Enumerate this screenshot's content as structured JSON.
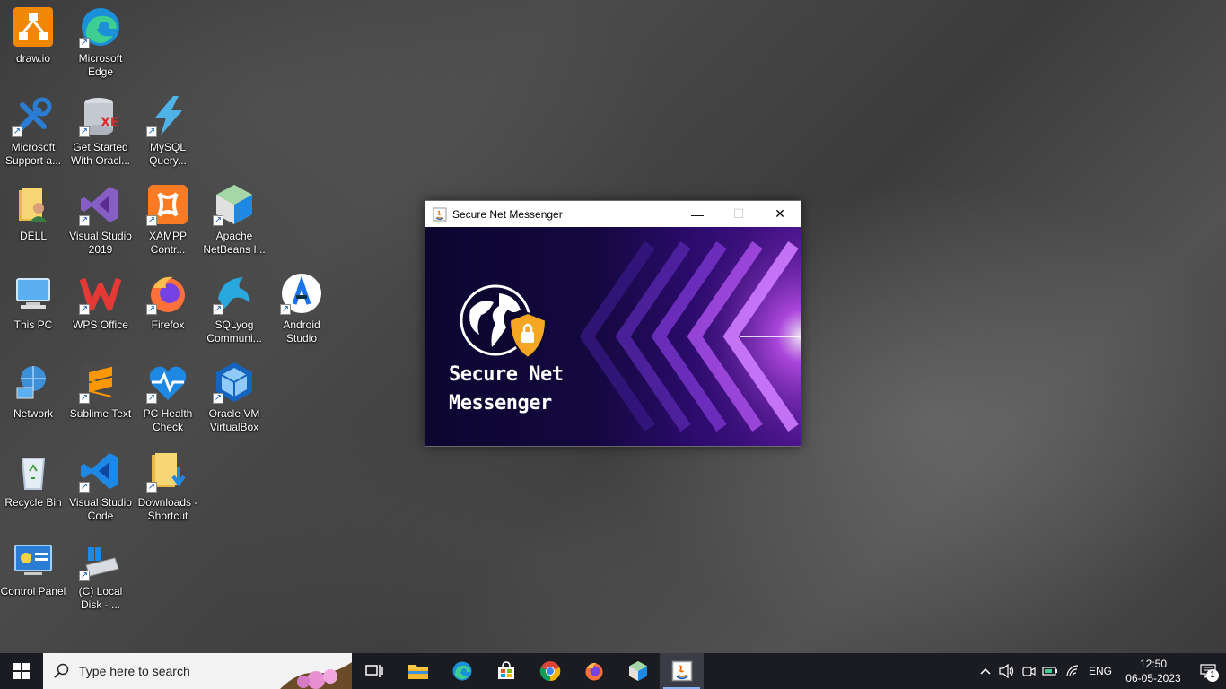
{
  "desktop": {
    "icons": [
      {
        "label": "draw.io",
        "icon": "drawio-icon"
      },
      {
        "label": "Microsoft Edge",
        "icon": "edge-icon"
      },
      {
        "label": "Microsoft Support a...",
        "icon": "tools-icon"
      },
      {
        "label": "Get Started With Oracl...",
        "icon": "oracle-db-icon"
      },
      {
        "label": "MySQL Query...",
        "icon": "lightning-icon"
      },
      {
        "label": "DELL",
        "icon": "user-folder-icon"
      },
      {
        "label": "Visual Studio 2019",
        "icon": "visual-studio-icon"
      },
      {
        "label": "XAMPP Contr...",
        "icon": "xampp-icon"
      },
      {
        "label": "Apache NetBeans I...",
        "icon": "netbeans-icon"
      },
      {
        "label": "This PC",
        "icon": "computer-icon"
      },
      {
        "label": "WPS Office",
        "icon": "wps-icon"
      },
      {
        "label": "Firefox",
        "icon": "firefox-icon"
      },
      {
        "label": "SQLyog Communi...",
        "icon": "dolphin-icon"
      },
      {
        "label": "Android Studio",
        "icon": "android-studio-icon"
      },
      {
        "label": "Network",
        "icon": "network-icon"
      },
      {
        "label": "Sublime Text",
        "icon": "sublime-icon"
      },
      {
        "label": "PC Health Check",
        "icon": "health-icon"
      },
      {
        "label": "Oracle VM VirtualBox",
        "icon": "virtualbox-icon"
      },
      {
        "label": "Recycle Bin",
        "icon": "recycle-bin-icon"
      },
      {
        "label": "Visual Studio Code",
        "icon": "vscode-icon"
      },
      {
        "label": "Downloads - Shortcut",
        "icon": "downloads-folder-icon"
      },
      {
        "label": "Control Panel",
        "icon": "control-panel-icon"
      },
      {
        "label": "(C) Local Disk - ...",
        "icon": "disk-icon"
      }
    ]
  },
  "window": {
    "title": "Secure Net Messenger",
    "splash_line1": "Secure Net",
    "splash_line2": "Messenger",
    "minimize_glyph": "—",
    "maximize_glyph": "☐",
    "close_glyph": "✕"
  },
  "taskbar": {
    "search_placeholder": "Type here to search",
    "apps": [
      "task-view-icon",
      "file-explorer-icon",
      "edge-icon",
      "store-icon",
      "chrome-icon",
      "firefox-icon",
      "netbeans-icon",
      "java-icon"
    ],
    "active_app": "java-icon",
    "tray": {
      "language": "ENG",
      "time": "12:50",
      "date": "06-05-2023",
      "notification_count": "1"
    }
  },
  "colors": {
    "taskbar_bg": "#1b1c22",
    "splash_dark": "#0c0630",
    "splash_purple": "#4a148c",
    "shield_orange": "#f5a623"
  }
}
